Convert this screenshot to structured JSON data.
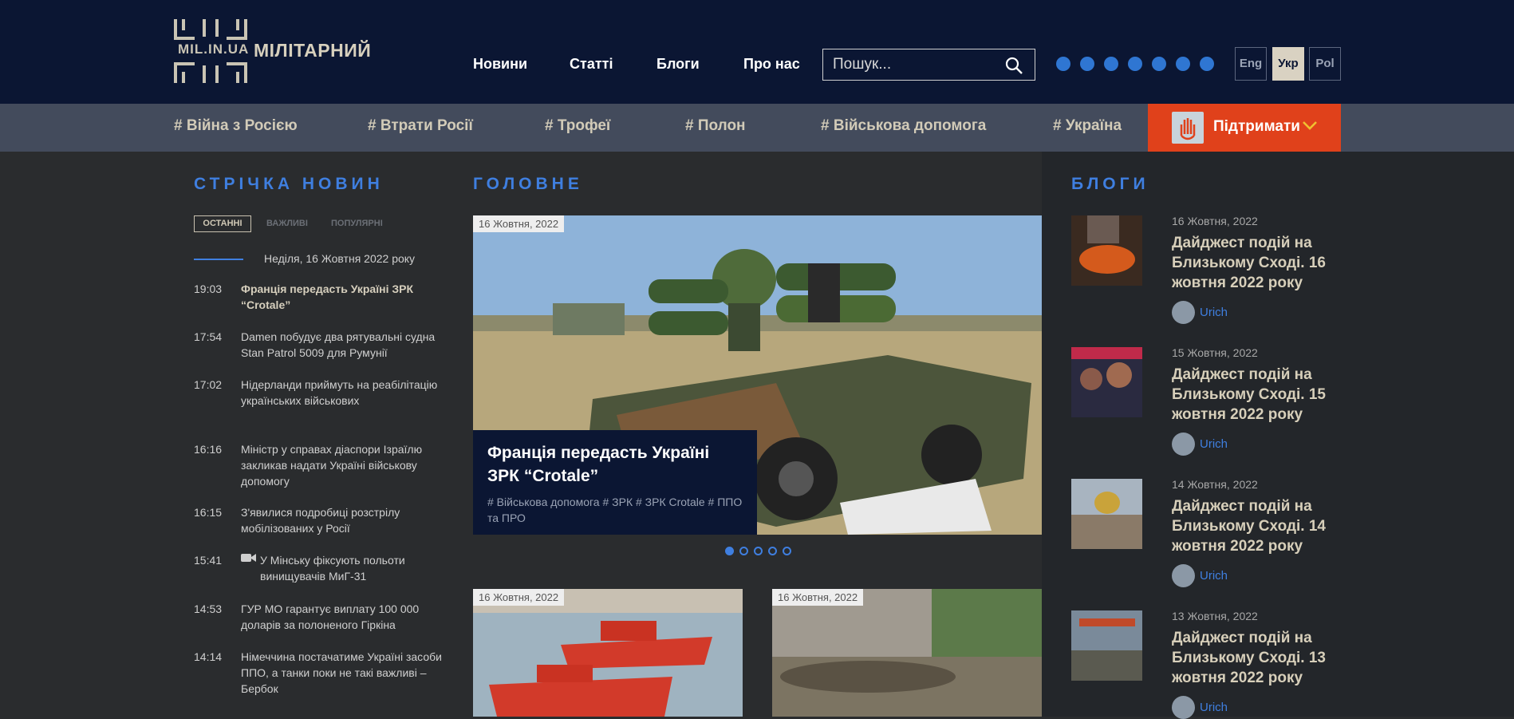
{
  "header": {
    "logo_text": "MIL.IN.UA",
    "site_name": "МІЛІТАРНИЙ",
    "nav": [
      "Новини",
      "Статті",
      "Блоги",
      "Про нас"
    ],
    "search_placeholder": "Пошук...",
    "social": [
      "facebook-icon",
      "twitter-icon",
      "youtube-icon",
      "instagram-icon",
      "telegram-icon",
      "viber-icon",
      "rss-icon"
    ],
    "languages": [
      {
        "label": "Eng",
        "active": false
      },
      {
        "label": "Укр",
        "active": true
      },
      {
        "label": "Pol",
        "active": false
      }
    ]
  },
  "tags": [
    "# Війна з Росією",
    "# Втрати Росії",
    "# Трофеї",
    "# Полон",
    "# Військова допомога",
    "# Україна"
  ],
  "support": {
    "label": "Підтримати"
  },
  "feed": {
    "title": "СТРІЧКА НОВИН",
    "filters": [
      "ОСТАННІ",
      "ВАЖЛИВІ",
      "ПОПУЛЯРНІ"
    ],
    "day": "Неділя, 16 Жовтня 2022 року",
    "items": [
      {
        "time": "19:03",
        "text": "Франція передасть Україні ЗРК “Crotale”"
      },
      {
        "time": "17:54",
        "text": "Damen побудує два рятувальні судна Stan Patrol 5009 для Румунії"
      },
      {
        "time": "17:02",
        "text": "Нідерланди приймуть на реабілітацію українських військових"
      },
      {
        "time": "16:16",
        "text": "Міністр у справах діаспори Ізраїлю закликав надати Україні військову допомогу"
      },
      {
        "time": "16:15",
        "text": "З'явилися подробиці розстрілу мобілізованих у Росії"
      },
      {
        "time": "15:41",
        "text": "У Мінську фіксують польоти винищувачів МиГ-31"
      },
      {
        "time": "14:53",
        "text": "ГУР МО гарантує виплату 100 000 доларів за полоненого Гіркіна"
      },
      {
        "time": "14:14",
        "text": "Німеччина постачатиме Україні засоби ППО, а танки поки не такі важливі – Бербок"
      }
    ]
  },
  "main": {
    "title": "ГОЛОВНЕ",
    "slide": {
      "date": "16 Жовтня, 2022",
      "title": "Франція передасть Україні ЗРК “Crotale”",
      "tags": "# Військова допомога  # ЗРК  # ЗРК Crotale  # ППО та ПРО"
    },
    "thumbs": [
      {
        "date": "16 Жовтня, 2022"
      },
      {
        "date": "16 Жовтня, 2022"
      }
    ]
  },
  "blogs": {
    "title": "БЛОГИ",
    "items": [
      {
        "date": "16 Жовтня, 2022",
        "title": "Дайджест подій на Близькому Сході. 16 жовтня 2022 року",
        "author": "Urich"
      },
      {
        "date": "15 Жовтня, 2022",
        "title": "Дайджест подій на Близькому Сході. 15 жовтня 2022 року",
        "author": "Urich"
      },
      {
        "date": "14 Жовтня, 2022",
        "title": "Дайджест подій на Близькому Сході. 14 жовтня 2022 року",
        "author": "Urich"
      },
      {
        "date": "13 Жовтня, 2022",
        "title": "Дайджест подій на Близькому Сході. 13 жовтня 2022 року",
        "author": "Urich"
      }
    ]
  }
}
